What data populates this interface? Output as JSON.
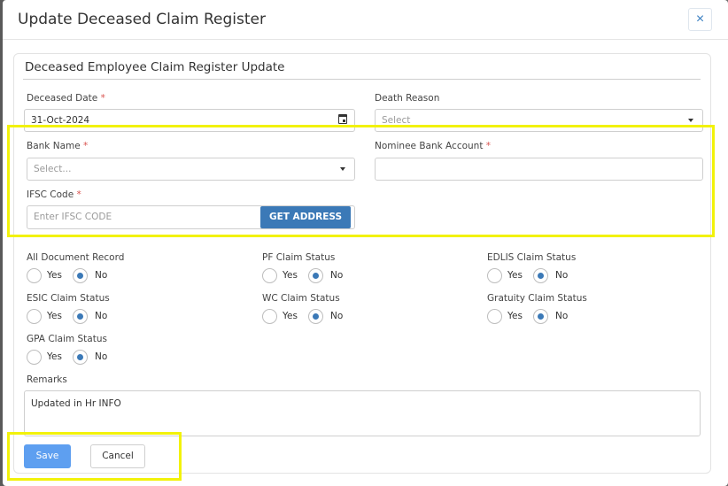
{
  "modal": {
    "title": "Update Deceased Claim Register",
    "close_label": "×"
  },
  "card": {
    "title": "Deceased Employee Claim Register Update"
  },
  "fields": {
    "deceased_date": {
      "label": "Deceased Date",
      "required": "*",
      "value": "31-Oct-2024"
    },
    "death_reason": {
      "label": "Death Reason",
      "placeholder": "Select"
    },
    "bank_name": {
      "label": "Bank Name",
      "required": "*",
      "placeholder": "Select..."
    },
    "nominee_bank_account": {
      "label": "Nominee Bank Account",
      "required": "*",
      "value": ""
    },
    "ifsc_code": {
      "label": "IFSC Code",
      "required": "*",
      "placeholder": "Enter IFSC CODE",
      "button": "GET ADDRESS"
    }
  },
  "statuses": [
    {
      "label": "All Document Record",
      "yes": "Yes",
      "no": "No",
      "selected": "No"
    },
    {
      "label": "PF Claim Status",
      "yes": "Yes",
      "no": "No",
      "selected": "No"
    },
    {
      "label": "EDLIS Claim Status",
      "yes": "Yes",
      "no": "No",
      "selected": "No"
    },
    {
      "label": "ESIC Claim Status",
      "yes": "Yes",
      "no": "No",
      "selected": "No"
    },
    {
      "label": "WC Claim Status",
      "yes": "Yes",
      "no": "No",
      "selected": "No"
    },
    {
      "label": "Gratuity Claim Status",
      "yes": "Yes",
      "no": "No",
      "selected": "No"
    },
    {
      "label": "GPA Claim Status",
      "yes": "Yes",
      "no": "No",
      "selected": "No"
    }
  ],
  "remarks": {
    "label": "Remarks",
    "value": "Updated in Hr INFO"
  },
  "actions": {
    "save": "Save",
    "cancel": "Cancel"
  },
  "colors": {
    "primary": "#3b79b7",
    "save": "#5e9ff0",
    "highlight": "#f2f20a",
    "required": "#d9534f"
  }
}
